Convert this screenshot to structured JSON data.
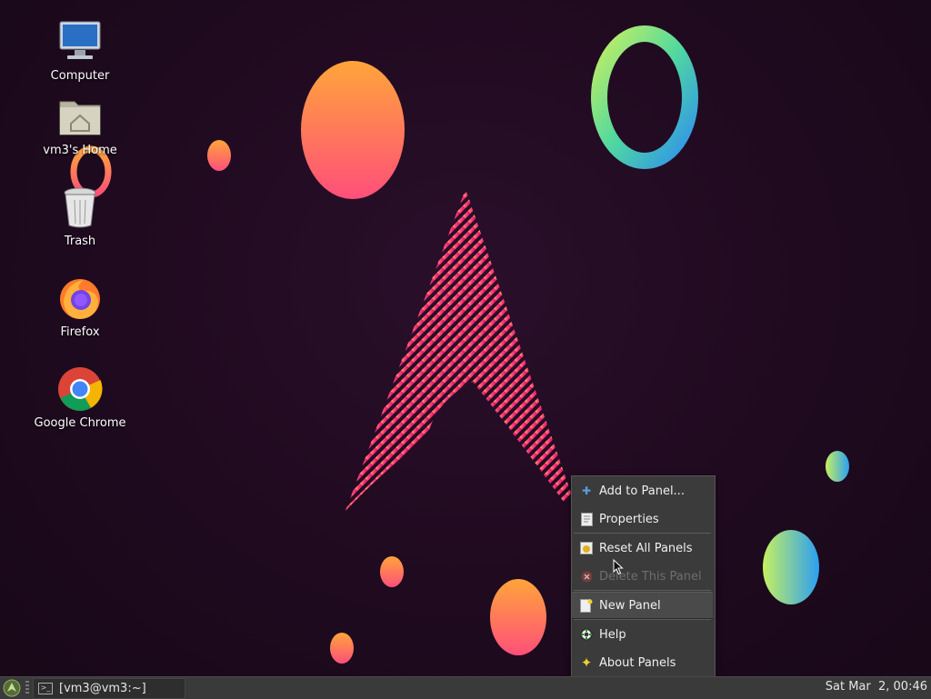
{
  "desktop": {
    "icons": [
      {
        "label": "Computer",
        "icon": "computer-icon"
      },
      {
        "label": "vm3's Home",
        "icon": "home-folder-icon"
      },
      {
        "label": "Trash",
        "icon": "trash-icon"
      },
      {
        "label": "Firefox",
        "icon": "firefox-icon"
      },
      {
        "label": "Google Chrome",
        "icon": "chrome-icon"
      }
    ]
  },
  "context_menu": {
    "items": [
      {
        "label": "Add to Panel...",
        "icon": "plus-icon",
        "enabled": true
      },
      {
        "label": "Properties",
        "icon": "properties-icon",
        "enabled": true
      },
      {
        "label": "Reset All Panels",
        "icon": "reset-icon",
        "enabled": true
      },
      {
        "label": "Delete This Panel",
        "icon": "delete-icon",
        "enabled": false
      },
      {
        "label": "New Panel",
        "icon": "new-panel-icon",
        "enabled": true,
        "highlighted": true
      },
      {
        "label": "Help",
        "icon": "help-icon",
        "enabled": true
      },
      {
        "label": "About Panels",
        "icon": "about-icon",
        "enabled": true
      }
    ]
  },
  "panel": {
    "task_label": "[vm3@vm3:~]",
    "clock": "Sat Mar  2, 00:46"
  },
  "colors": {
    "background": "#1f0a1f",
    "panel": "#3a3a3a",
    "menu": "#3b3b3b"
  }
}
